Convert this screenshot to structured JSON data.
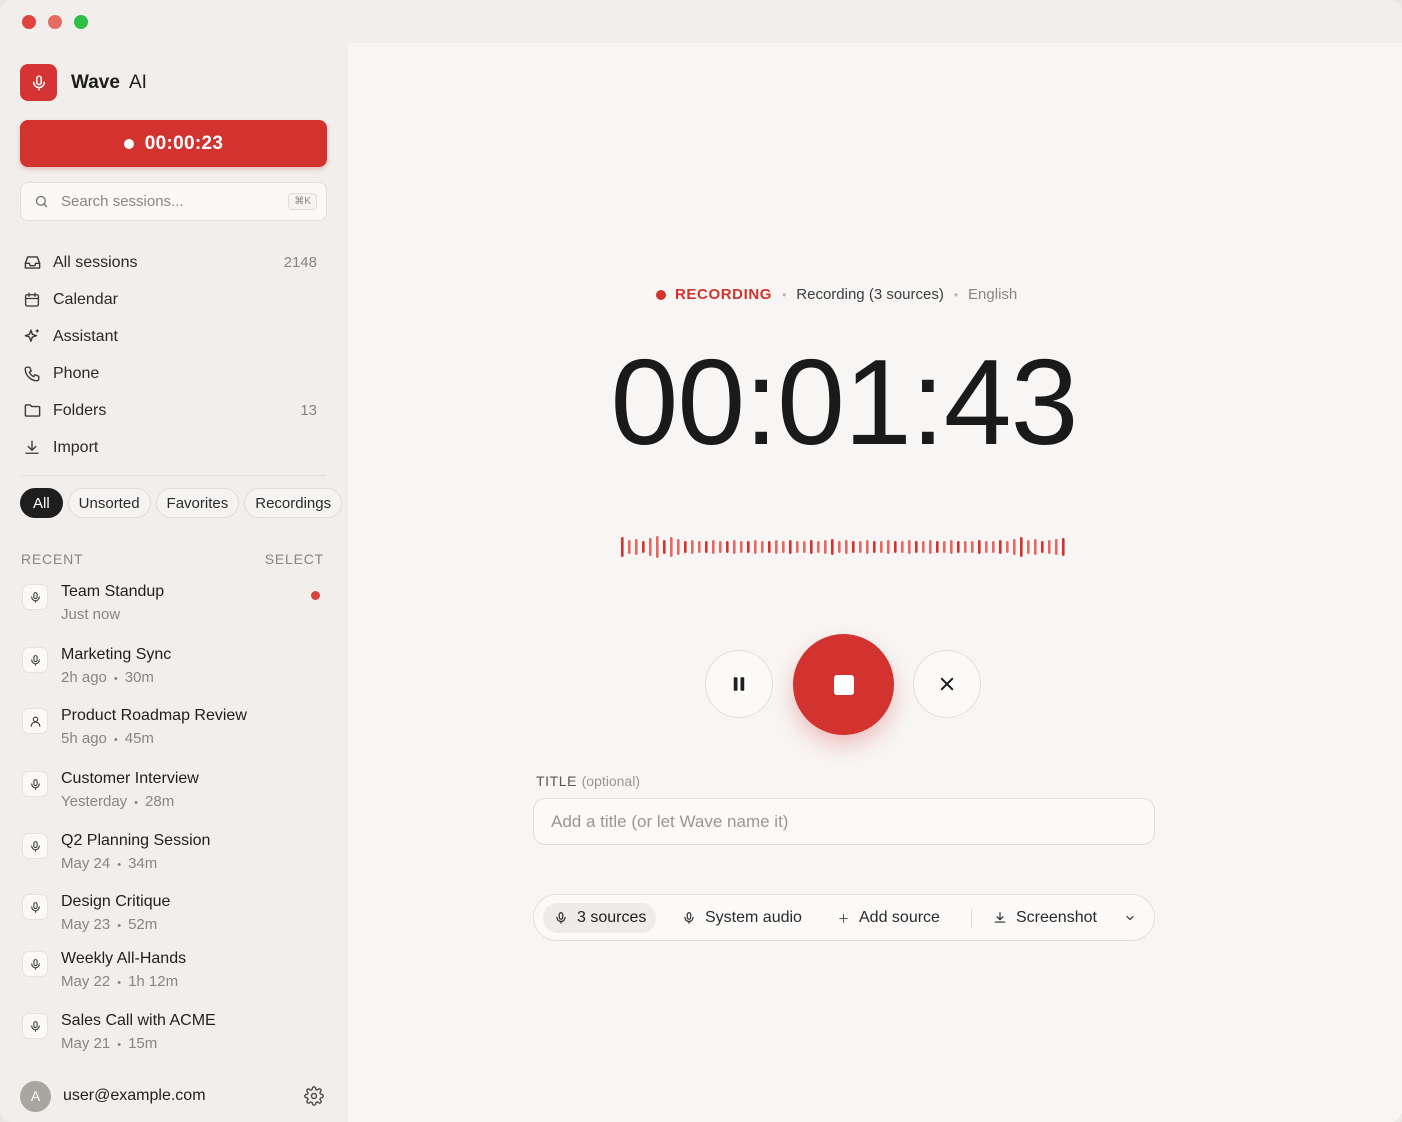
{
  "app": {
    "name": "Wave",
    "suffix": "AI"
  },
  "sidebar": {
    "record_button": {
      "elapsed": "00:00:23"
    },
    "search": {
      "placeholder": "Search sessions...",
      "shortcut": "⌘K"
    },
    "nav": [
      {
        "label": "All sessions",
        "count": "2148",
        "icon": "inbox-icon"
      },
      {
        "label": "Calendar",
        "count": "",
        "icon": "calendar-icon"
      },
      {
        "label": "Assistant",
        "count": "",
        "icon": "sparkle-icon"
      },
      {
        "label": "Phone",
        "count": "",
        "icon": "phone-icon"
      },
      {
        "label": "Folders",
        "count": "13",
        "icon": "folder-icon"
      },
      {
        "label": "Import",
        "count": "",
        "icon": "download-icon"
      }
    ],
    "filters": [
      "All",
      "Unsorted",
      "Favorites",
      "Recordings"
    ],
    "recent_label": "RECENT",
    "select_label": "SELECT",
    "sessions": [
      {
        "title": "Team Standup",
        "when": "Just now",
        "duration": "",
        "icon": "mic-icon",
        "live": true
      },
      {
        "title": "Marketing Sync",
        "when": "2h ago",
        "duration": "30m",
        "icon": "mic-icon",
        "live": false
      },
      {
        "title": "Product Roadmap Review",
        "when": "5h ago",
        "duration": "45m",
        "icon": "person-icon",
        "live": false
      },
      {
        "title": "Customer Interview",
        "when": "Yesterday",
        "duration": "28m",
        "icon": "mic-icon",
        "live": false
      },
      {
        "title": "Q2 Planning Session",
        "when": "May 24",
        "duration": "34m",
        "icon": "mic-icon",
        "live": false
      },
      {
        "title": "Design Critique",
        "when": "May 23",
        "duration": "52m",
        "icon": "mic-icon",
        "live": false
      },
      {
        "title": "Weekly All-Hands",
        "when": "May 22",
        "duration": "1h 12m",
        "icon": "mic-icon",
        "live": false
      },
      {
        "title": "Sales Call with ACME",
        "when": "May 21",
        "duration": "15m",
        "icon": "mic-icon",
        "live": false
      }
    ],
    "user": {
      "initial": "A",
      "email": "user@example.com"
    }
  },
  "main": {
    "status": {
      "state": "RECORDING",
      "sources": "Recording (3 sources)",
      "language": "English"
    },
    "timer": "00:01:43",
    "title_field": {
      "label": "TITLE",
      "optional": "(optional)",
      "placeholder": "Add a title (or let Wave name it)"
    },
    "source_bar": {
      "sources": "3 sources",
      "system_audio": "System audio",
      "add_source": "Add source",
      "screenshot": "Screenshot"
    }
  },
  "colors": {
    "accent": "#d2332f",
    "sidebar_bg": "#f1eeeb",
    "main_bg": "#f8f6f4"
  }
}
